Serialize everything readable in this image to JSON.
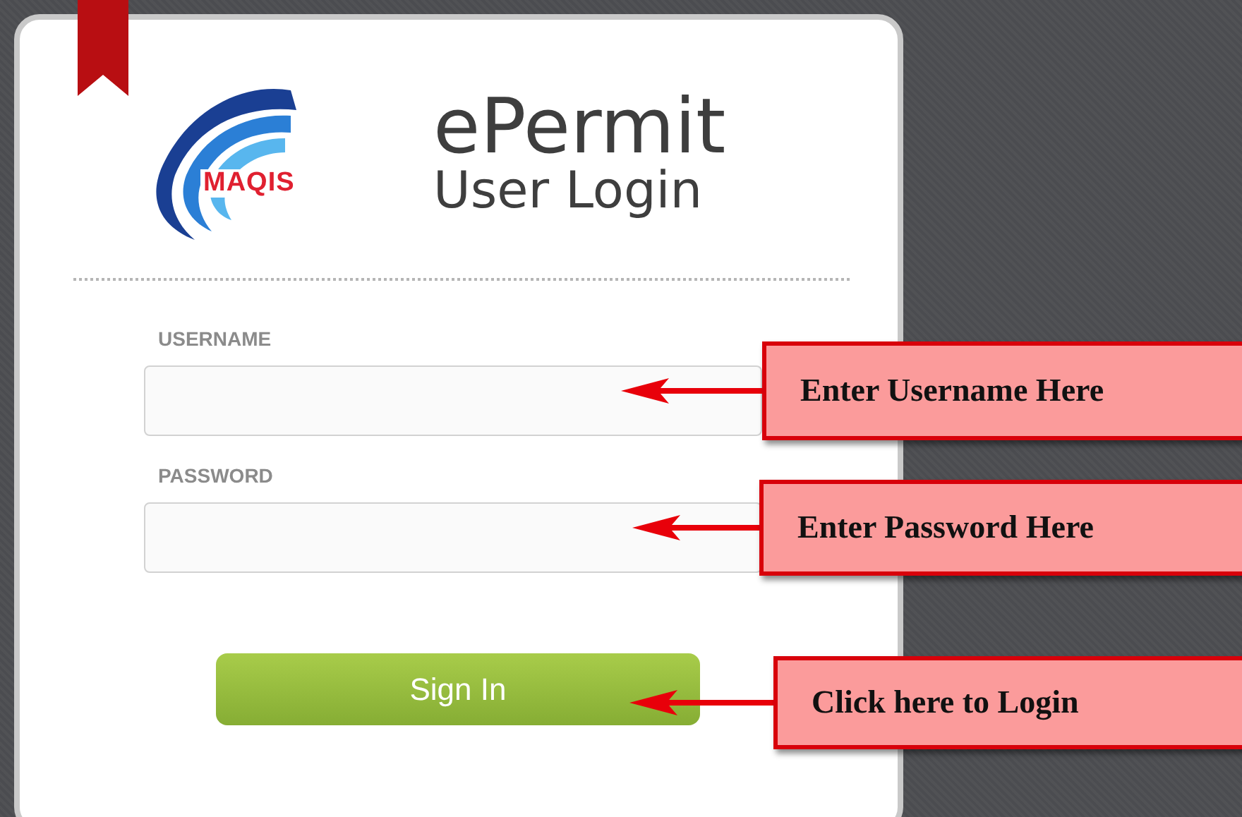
{
  "logo": {
    "text": "MAQIS"
  },
  "header": {
    "title": "ePermit",
    "subtitle": "User Login"
  },
  "fields": [
    {
      "label": "USERNAME"
    },
    {
      "label": "PASSWORD"
    }
  ],
  "button": {
    "label": "Sign In"
  },
  "callouts": [
    {
      "text": "Enter Username Here"
    },
    {
      "text": "Enter Password Here"
    },
    {
      "text": "Click here to Login"
    }
  ]
}
